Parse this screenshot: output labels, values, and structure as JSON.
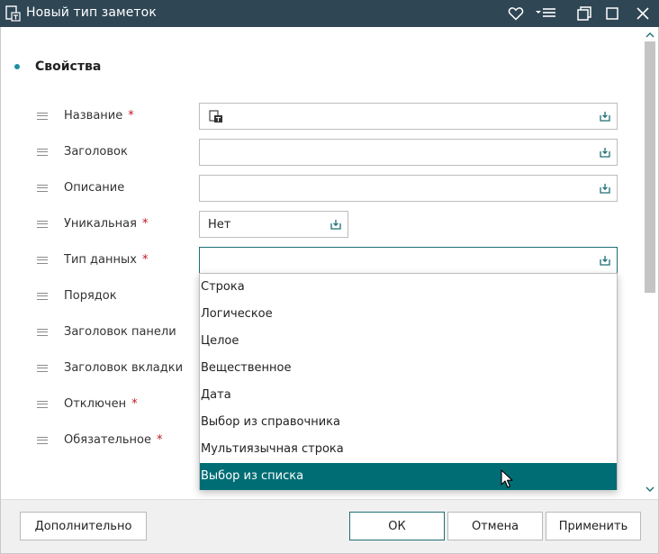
{
  "window": {
    "title": "Новый тип заметок"
  },
  "section": {
    "title": "Свойства"
  },
  "rows": [
    {
      "label": "Название",
      "required": "*"
    },
    {
      "label": "Заголовок",
      "required": ""
    },
    {
      "label": "Описание",
      "required": ""
    },
    {
      "label": "Уникальная",
      "required": "*"
    },
    {
      "label": "Тип данных",
      "required": "*"
    },
    {
      "label": "Порядок",
      "required": ""
    },
    {
      "label": "Заголовок панели",
      "required": ""
    },
    {
      "label": "Заголовок вкладки",
      "required": ""
    },
    {
      "label": "Отключен",
      "required": "*"
    },
    {
      "label": "Обязательное",
      "required": "*"
    }
  ],
  "fields": {
    "name_value": "",
    "title_value": "",
    "description_value": "",
    "unique_value": "Нет",
    "datatype_value": ""
  },
  "dropdown": {
    "options": [
      "Строка",
      "Логическое",
      "Целое",
      "Вещественное",
      "Дата",
      "Выбор из справочника",
      "Мультиязычная строка",
      "Выбор из списка"
    ],
    "highlighted": "Выбор из списка"
  },
  "footer": {
    "more_label": "Дополнительно",
    "ok_label": "ОК",
    "cancel_label": "Отмена",
    "apply_label": "Применить"
  },
  "colors": {
    "titlebar": "#2f4655",
    "accent": "#006d74",
    "required": "#c0161f"
  },
  "icons": {
    "app": "note-document-icon",
    "favorite": "heart-icon",
    "menu": "hamburger-menu-icon",
    "restore": "restore-window-icon",
    "maximize": "maximize-icon",
    "close": "close-icon",
    "field_expand": "expand-field-icon"
  }
}
